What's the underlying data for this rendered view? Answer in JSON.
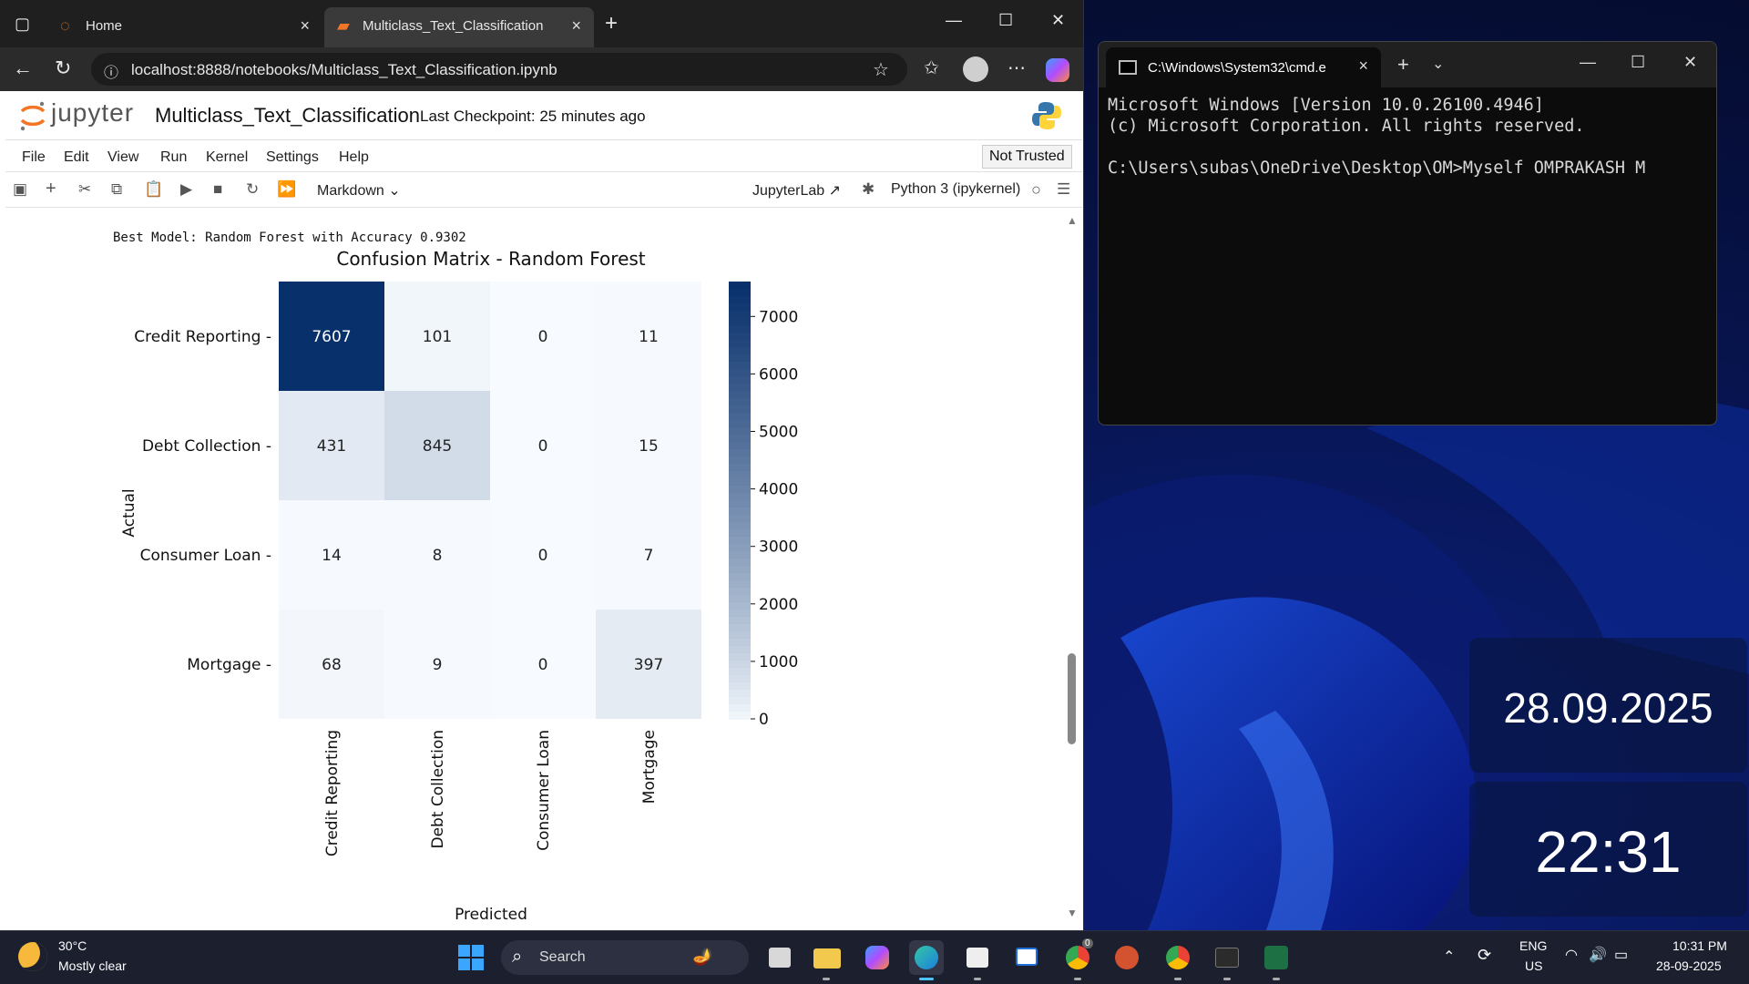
{
  "browser": {
    "tabs": [
      {
        "label": "Home"
      },
      {
        "label": "Multiclass_Text_Classification"
      }
    ],
    "url": "localhost:8888/notebooks/Multiclass_Text_Classification.ipynb"
  },
  "jupyter": {
    "logo_text": "jupyter",
    "notebook_title": "Multiclass_Text_Classification",
    "checkpoint": "Last Checkpoint: 25 minutes ago",
    "menu": [
      "File",
      "Edit",
      "View",
      "Run",
      "Kernel",
      "Settings",
      "Help"
    ],
    "not_trusted": "Not Trusted",
    "cell_type": "Markdown",
    "jupyterlab_label": "JupyterLab",
    "kernel": "Python 3 (ipykernel)",
    "output_text": "Best Model: Random Forest with Accuracy 0.9302"
  },
  "chart_data": {
    "type": "heatmap",
    "title": "Confusion Matrix - Random Forest",
    "xlabel": "Predicted",
    "ylabel": "Actual",
    "rows": [
      "Credit Reporting",
      "Debt Collection",
      "Consumer Loan",
      "Mortgage"
    ],
    "columns": [
      "Credit Reporting",
      "Debt Collection",
      "Consumer Loan",
      "Mortgage"
    ],
    "values": [
      [
        7607,
        101,
        0,
        11
      ],
      [
        431,
        845,
        0,
        15
      ],
      [
        14,
        8,
        0,
        7
      ],
      [
        68,
        9,
        0,
        397
      ]
    ],
    "colorbar_ticks": [
      0,
      1000,
      2000,
      3000,
      4000,
      5000,
      6000,
      7000
    ],
    "colorbar_range": [
      0,
      7607
    ],
    "colormap": "Blues",
    "grid": false
  },
  "cmd": {
    "tab_title": "C:\\Windows\\System32\\cmd.e",
    "lines": [
      "Microsoft Windows [Version 10.0.26100.4946]",
      "(c) Microsoft Corporation. All rights reserved.",
      "",
      "C:\\Users\\subas\\OneDrive\\Desktop\\OM>Myself OMPRAKASH M"
    ]
  },
  "widgets": {
    "date": "28.09.2025",
    "time": "22:31"
  },
  "taskbar": {
    "weather_temp": "30°C",
    "weather_desc": "Mostly clear",
    "search_placeholder": "Search",
    "lang": "ENG",
    "region": "US",
    "clock_time": "10:31 PM",
    "clock_date": "28-09-2025",
    "badge_count": "0"
  },
  "colors": {
    "tab_active": "#3a3a3a",
    "accent_orange": "#f37626",
    "heatmap_dark": "#08306b",
    "heatmap_light": "#f7fbff"
  }
}
